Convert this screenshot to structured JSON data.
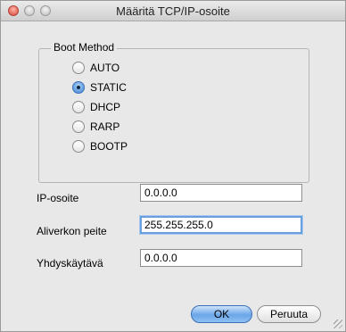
{
  "window": {
    "title": "Määritä TCP/IP-osoite"
  },
  "boot_method": {
    "title": "Boot Method",
    "options": [
      {
        "label": "AUTO",
        "checked": false
      },
      {
        "label": "STATIC",
        "checked": true
      },
      {
        "label": "DHCP",
        "checked": false
      },
      {
        "label": "RARP",
        "checked": false
      },
      {
        "label": "BOOTP",
        "checked": false
      }
    ]
  },
  "fields": {
    "ip": {
      "label": "IP-osoite",
      "value": "0.0.0.0"
    },
    "subnet": {
      "label": "Aliverkon peite",
      "value": "255.255.255.0"
    },
    "gateway": {
      "label": "Yhdyskäytävä",
      "value": "0.0.0.0"
    }
  },
  "buttons": {
    "ok": "OK",
    "cancel": "Peruuta"
  }
}
